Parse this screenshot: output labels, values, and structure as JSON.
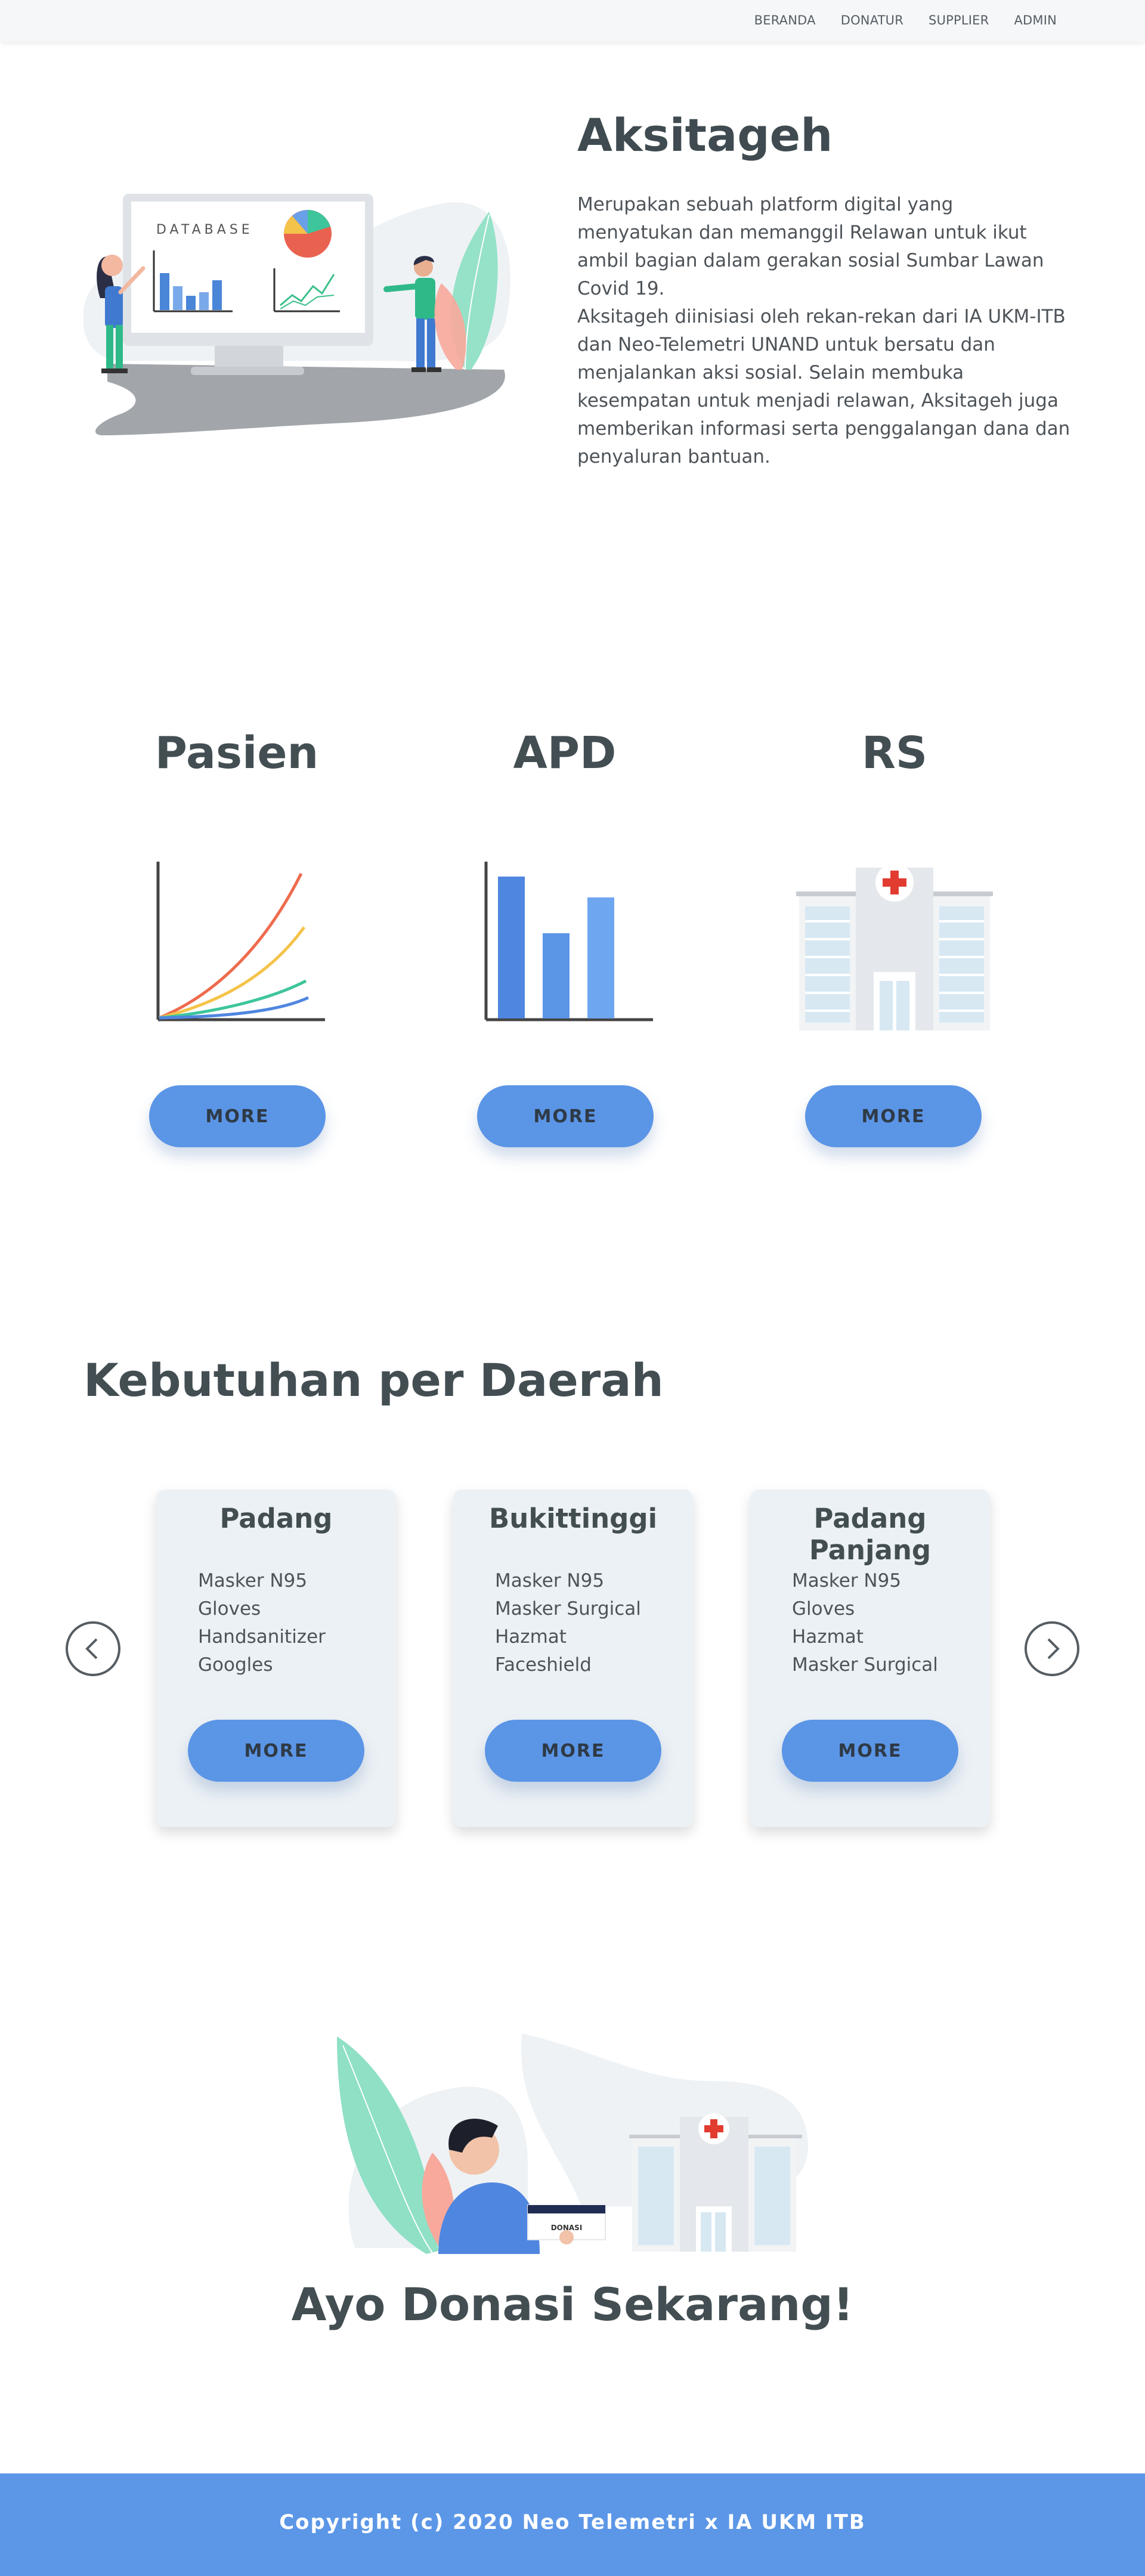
{
  "nav": {
    "items": [
      {
        "label": "BERANDA"
      },
      {
        "label": "DONATUR"
      },
      {
        "label": "SUPPLIER"
      },
      {
        "label": "ADMIN"
      }
    ]
  },
  "hero": {
    "title": "Aksitageh",
    "paragraph1": "Merupakan sebuah platform digital yang menyatukan dan memanggil Relawan untuk ikut ambil bagian dalam gerakan sosial Sumbar Lawan Covid 19.",
    "paragraph2": "Aksitageh diinisiasi oleh rekan-rekan dari IA UKM-ITB dan Neo-Telemetri UNAND untuk bersatu dan menjalankan aksi sosial. Selain membuka kesempatan untuk menjadi relawan, Aksitageh juga memberikan informasi serta penggalangan dana dan penyaluran bantuan.",
    "illustration_label": "DATABASE"
  },
  "stats": [
    {
      "title": "Pasien",
      "button": "MORE",
      "icon": "line-chart-icon"
    },
    {
      "title": "APD",
      "button": "MORE",
      "icon": "bar-chart-icon"
    },
    {
      "title": "RS",
      "button": "MORE",
      "icon": "hospital-icon"
    }
  ],
  "regions": {
    "title": "Kebutuhan per Daerah",
    "cards": [
      {
        "name": "Padang",
        "items": [
          "Masker N95",
          "Gloves",
          "Handsanitizer",
          "Googles"
        ],
        "button": "MORE"
      },
      {
        "name": "Bukittinggi",
        "items": [
          "Masker N95",
          "Masker Surgical",
          "Hazmat",
          "Faceshield"
        ],
        "button": "MORE"
      },
      {
        "name": "Padang Panjang",
        "items": [
          "Masker N95",
          "Gloves",
          "Hazmat",
          "Masker Surgical"
        ],
        "button": "MORE"
      }
    ],
    "prev_icon": "chevron-left-icon",
    "next_icon": "chevron-right-icon"
  },
  "donate": {
    "title": "Ayo Donasi Sekarang!",
    "box_label": "DONASI"
  },
  "footer": {
    "text": "Copyright (c) 2020 Neo Telemetri x IA UKM ITB"
  },
  "colors": {
    "accent": "#5b95e6",
    "footer": "#5c97e7",
    "text": "#434e53",
    "card": "#ecf1f5"
  }
}
